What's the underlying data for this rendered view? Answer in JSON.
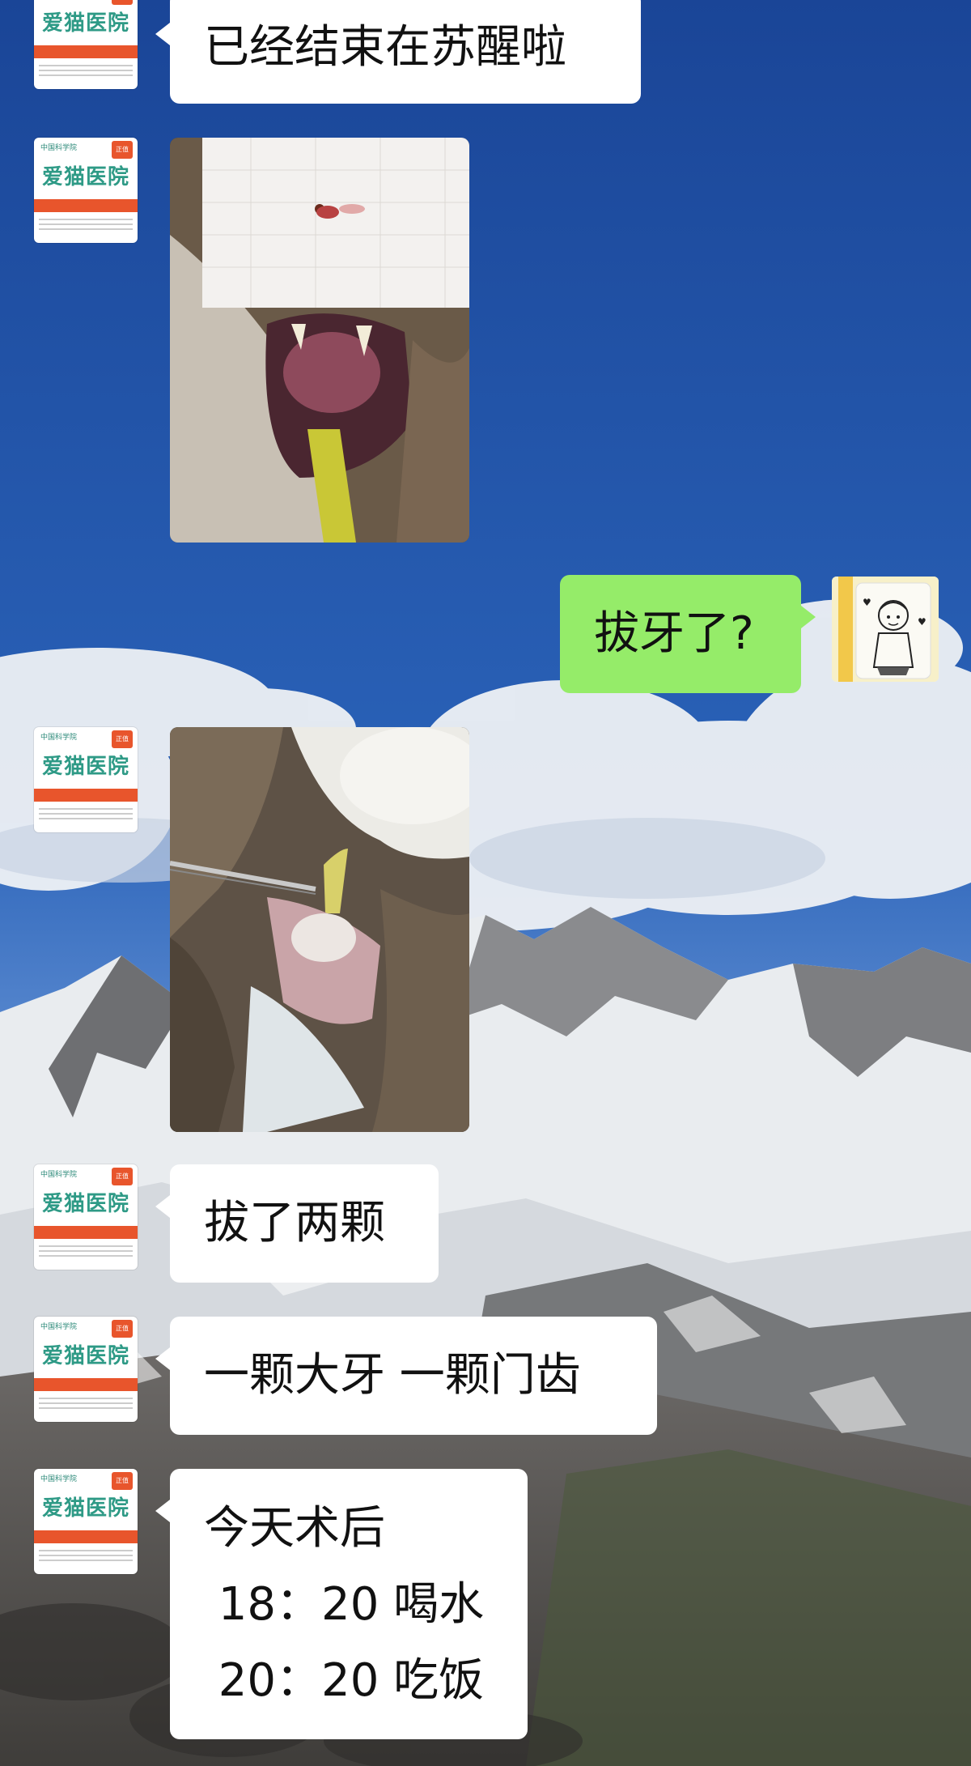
{
  "chat": {
    "messages": [
      {
        "sender": "clinic",
        "type": "text",
        "text": "已经结束在苏醒啦"
      },
      {
        "sender": "clinic",
        "type": "image",
        "image": "cat-mouth-gauze-photo"
      },
      {
        "sender": "me",
        "type": "text",
        "text": "拔牙了?"
      },
      {
        "sender": "clinic",
        "type": "image",
        "image": "cat-tooth-extraction-photo"
      },
      {
        "sender": "clinic",
        "type": "text",
        "text": "拔了两颗"
      },
      {
        "sender": "clinic",
        "type": "text",
        "text": "一颗大牙 一颗门齿"
      },
      {
        "sender": "clinic",
        "type": "text",
        "lines": [
          "今天术后",
          " 18：20 喝水",
          " 20：20 吃饭"
        ]
      }
    ]
  },
  "clinic_avatar": {
    "title": "爱猫医院",
    "top_text": "中国科学院",
    "badge": "正值"
  },
  "colors": {
    "bubble_incoming": "#ffffff",
    "bubble_outgoing": "#95ec69",
    "avatar_accent": "#2e9a86",
    "avatar_strip": "#e8552c"
  }
}
